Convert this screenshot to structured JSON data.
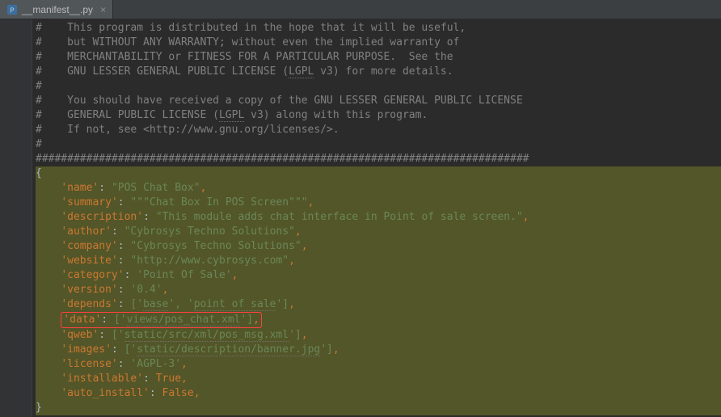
{
  "tab": {
    "filename": "__manifest__.py"
  },
  "comments": [
    "#    This program is distributed in the hope that it will be useful,",
    "#    but WITHOUT ANY WARRANTY; without even the implied warranty of",
    "#    MERCHANTABILITY or FITNESS FOR A PARTICULAR PURPOSE.  See the",
    "#    GNU LESSER GENERAL PUBLIC LICENSE (LGPL v3) for more details.",
    "#",
    "#    You should have received a copy of the GNU LESSER GENERAL PUBLIC LICENSE",
    "#    GENERAL PUBLIC LICENSE (LGPL v3) along with this program.",
    "#    If not, see <http://www.gnu.org/licenses/>.",
    "#",
    "##############################################################################"
  ],
  "dict": {
    "name": "\"POS Chat Box\"",
    "summary": "\"\"\"Chat Box In POS Screen\"\"\"",
    "description": "\"This module adds chat interface in Point of sale screen.\"",
    "author": "\"Cybrosys Techno Solutions\"",
    "company": "\"Cybrosys Techno Solutions\"",
    "website": "\"http://www.cybrosys.com\"",
    "category": "'Point Of Sale'",
    "version": "'0.4'",
    "depends_prefix": "['",
    "depends_a": "base",
    "depends_mid": "', '",
    "depends_b": "point of sale",
    "depends_suffix": "']",
    "data_prefix": "['",
    "data_item": "views/pos_chat.xml",
    "data_suffix": "']",
    "qweb_prefix": "['",
    "qweb_item": "static/src/xml/pos_msg.xml",
    "qweb_suffix": "']",
    "images_prefix": "['",
    "images_item": "static/description/banner.jpg",
    "images_suffix": "']",
    "license": "'AGPL-3'",
    "installable": "True",
    "auto_install": "False"
  },
  "keys": {
    "name": "'name'",
    "summary": "'summary'",
    "description": "'description'",
    "author": "'author'",
    "company": "'company'",
    "website": "'website'",
    "category": "'category'",
    "version": "'version'",
    "depends": "'depends'",
    "data": "'data'",
    "qweb": "'qweb'",
    "images": "'images'",
    "license": "'license'",
    "installable": "'installable'",
    "auto_install": "'auto_install'"
  }
}
